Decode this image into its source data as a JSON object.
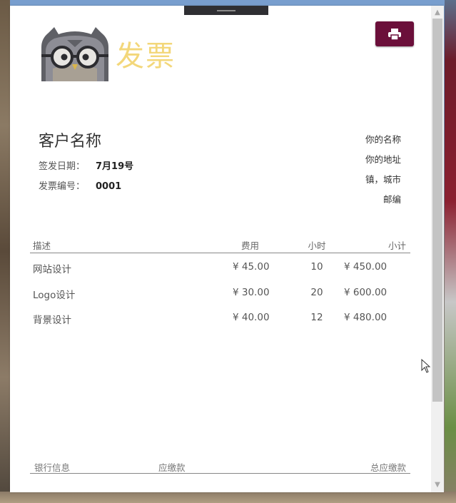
{
  "invoice": {
    "title": "发票",
    "client_name": "客户名称",
    "issue_date_label": "签发日期：",
    "issue_date_value": "7月19号",
    "invoice_no_label": "发票编号：",
    "invoice_no_value": "0001",
    "sender": {
      "name": "你的名称",
      "address": "你的地址",
      "town_city": "镇，城市",
      "postcode": "邮编"
    },
    "table": {
      "headers": {
        "desc": "描述",
        "rate": "费用",
        "hours": "小时",
        "subtotal": "小计"
      },
      "rows": [
        {
          "desc": "网站设计",
          "rate": "¥ 45.00",
          "hours": "10",
          "subtotal": "¥ 450.00"
        },
        {
          "desc": "Logo设计",
          "rate": "¥ 30.00",
          "hours": "20",
          "subtotal": "¥ 600.00"
        },
        {
          "desc": "背景设计",
          "rate": "¥ 40.00",
          "hours": "12",
          "subtotal": "¥ 480.00"
        }
      ]
    },
    "footer": {
      "bank": "银行信息",
      "due": "应缴款",
      "total_due": "总应缴款"
    }
  },
  "toolbar": {
    "print_icon": "printer-icon"
  },
  "colors": {
    "title": "#f3d77a",
    "print_button": "#6b0f3a"
  }
}
